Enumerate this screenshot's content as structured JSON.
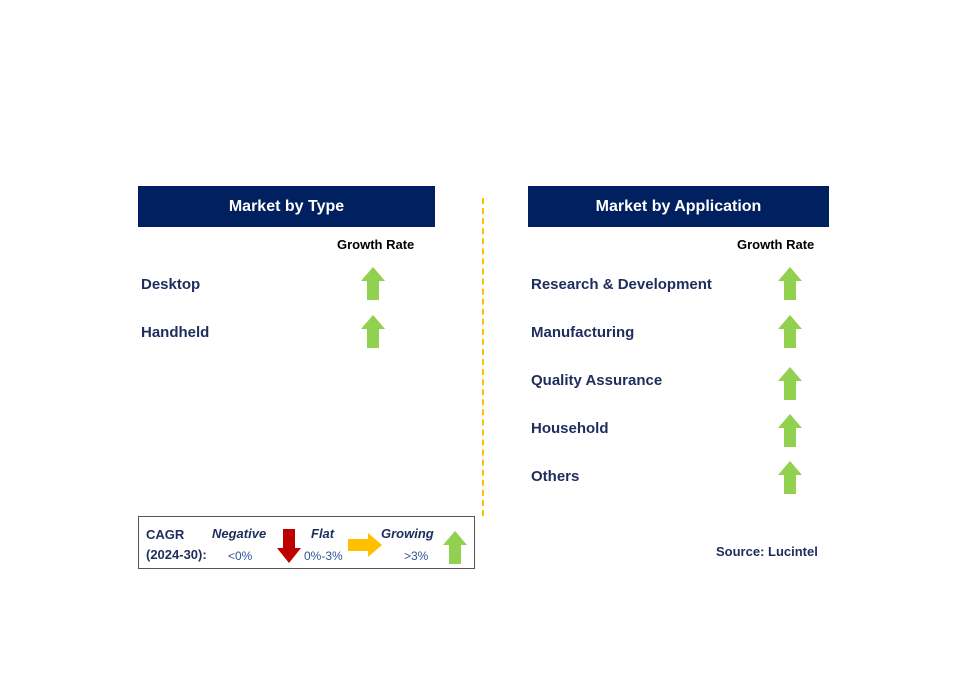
{
  "colors": {
    "header": "#002060",
    "up": "#92D050",
    "down": "#C00000",
    "flat": "#FFC000"
  },
  "left": {
    "title": "Market by Type",
    "growth_label": "Growth Rate",
    "items": [
      {
        "label": "Desktop",
        "trend": "up"
      },
      {
        "label": "Handheld",
        "trend": "up"
      }
    ]
  },
  "right": {
    "title": "Market by Application",
    "growth_label": "Growth Rate",
    "items": [
      {
        "label": "Research & Development",
        "trend": "up"
      },
      {
        "label": "Manufacturing",
        "trend": "up"
      },
      {
        "label": "Quality Assurance",
        "trend": "up"
      },
      {
        "label": "Household",
        "trend": "up"
      },
      {
        "label": "Others",
        "trend": "up"
      }
    ]
  },
  "legend": {
    "title_line1": "CAGR",
    "title_line2": "(2024-30):",
    "negative": "Negative",
    "negative_range": "<0%",
    "flat": "Flat",
    "flat_range": "0%-3%",
    "growing": "Growing",
    "growing_range": ">3%"
  },
  "source": "Source: Lucintel"
}
